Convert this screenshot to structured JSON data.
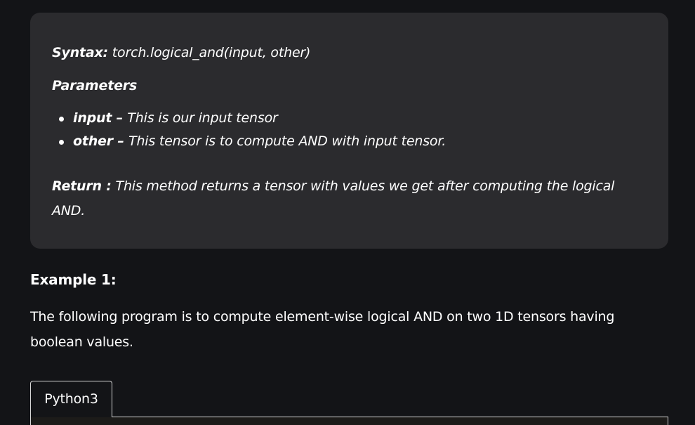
{
  "syntax": {
    "label": "Syntax:",
    "signature": "torch.logical_and(input, other)"
  },
  "parameters": {
    "heading": "Parameters",
    "items": [
      {
        "name": "input",
        "sep": " – ",
        "desc": " This is our input tensor"
      },
      {
        "name": "other",
        "sep": " – ",
        "desc": "This tensor is to compute AND with input tensor."
      }
    ]
  },
  "return": {
    "label": "Return :",
    "text": "This method returns a tensor with values we get after computing the logical AND."
  },
  "example": {
    "title": "Example 1:",
    "description": "The following program is to compute element-wise logical AND on two 1D tensors having boolean values."
  },
  "code_tabs": {
    "active": "Python3"
  }
}
